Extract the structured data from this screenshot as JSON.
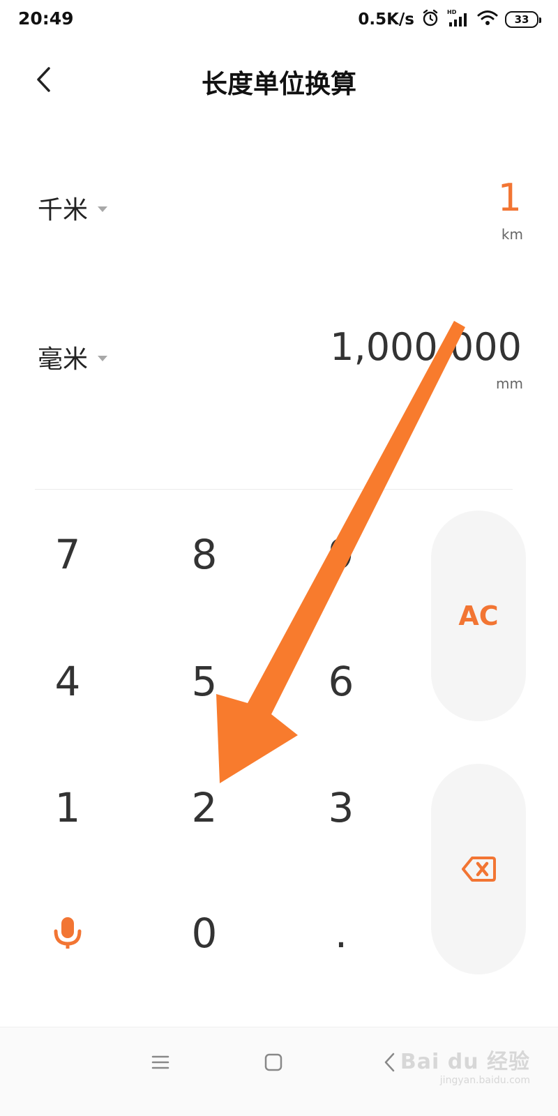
{
  "status_bar": {
    "time": "20:49",
    "net_speed": "0.5K/s",
    "battery": "33",
    "icons": [
      "alarm-icon",
      "hd-signal-icon",
      "wifi-icon",
      "battery-icon"
    ]
  },
  "header": {
    "title": "长度单位换算",
    "back_icon": "chevron-left-icon"
  },
  "from_unit": {
    "name": "千米",
    "value": "1",
    "abbr": "km"
  },
  "to_unit": {
    "name": "毫米",
    "value": "1,000,000",
    "abbr": "mm"
  },
  "keypad": {
    "k7": "7",
    "k8": "8",
    "k9": "9",
    "k4": "4",
    "k5": "5",
    "k6": "6",
    "k1": "1",
    "k2": "2",
    "k3": "3",
    "k0": "0",
    "dot": ".",
    "ac": "AC",
    "mic_icon": "microphone-icon",
    "backspace_icon": "backspace-icon"
  },
  "nav_bar": {
    "icons": [
      "menu-icon",
      "home-square-icon",
      "back-chevron-icon"
    ]
  },
  "watermark": {
    "main": "Bai du 经验",
    "sub": "jingyan.baidu.com"
  },
  "colors": {
    "accent": "#f27533",
    "arrow": "#f87b2d",
    "side_key_bg": "#f5f5f5"
  }
}
